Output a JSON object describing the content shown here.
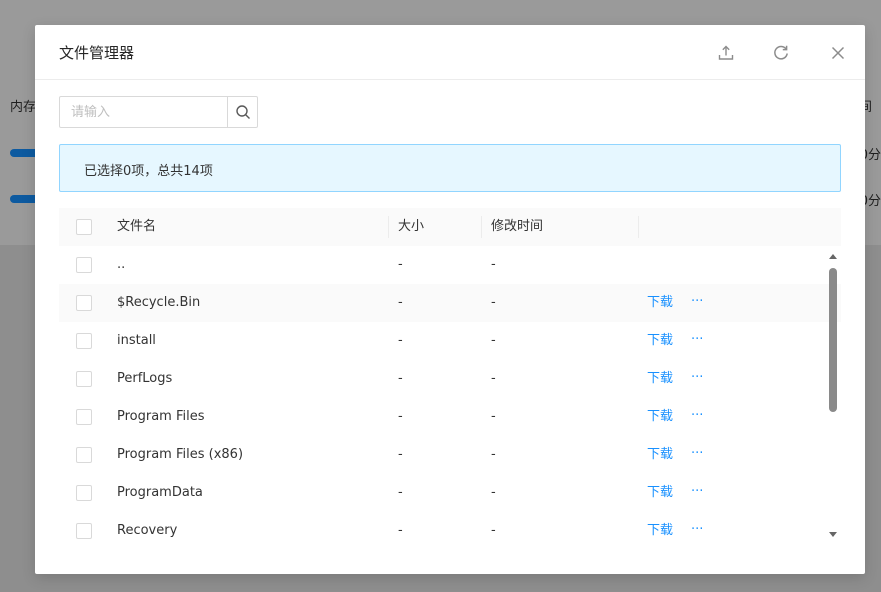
{
  "background": {
    "col1_header": "内存",
    "col_right_header": "间",
    "row1_right": "0分",
    "row2_right": "0分"
  },
  "modal": {
    "title": "文件管理器",
    "icons": [
      "upload-icon",
      "refresh-icon",
      "close-icon"
    ]
  },
  "search": {
    "placeholder": "请输入",
    "value": ""
  },
  "alert": {
    "text": "已选择0项，总共14项"
  },
  "table": {
    "columns": {
      "name": "文件名",
      "size": "大小",
      "modified": "修改时间"
    },
    "rows": [
      {
        "name": "..",
        "size": "-",
        "modified": "-",
        "download": "",
        "more": ""
      },
      {
        "name": "$Recycle.Bin",
        "size": "-",
        "modified": "-",
        "download": "下载",
        "more": "···"
      },
      {
        "name": "install",
        "size": "-",
        "modified": "-",
        "download": "下载",
        "more": "···"
      },
      {
        "name": "PerfLogs",
        "size": "-",
        "modified": "-",
        "download": "下载",
        "more": "···"
      },
      {
        "name": "Program Files",
        "size": "-",
        "modified": "-",
        "download": "下载",
        "more": "···"
      },
      {
        "name": "Program Files (x86)",
        "size": "-",
        "modified": "-",
        "download": "下载",
        "more": "···"
      },
      {
        "name": "ProgramData",
        "size": "-",
        "modified": "-",
        "download": "下载",
        "more": "···"
      },
      {
        "name": "Recovery",
        "size": "-",
        "modified": "-",
        "download": "下载",
        "more": "···"
      }
    ]
  },
  "colors": {
    "accent": "#1890ff",
    "alert_bg": "#e6f7ff",
    "alert_border": "#91d5ff"
  }
}
